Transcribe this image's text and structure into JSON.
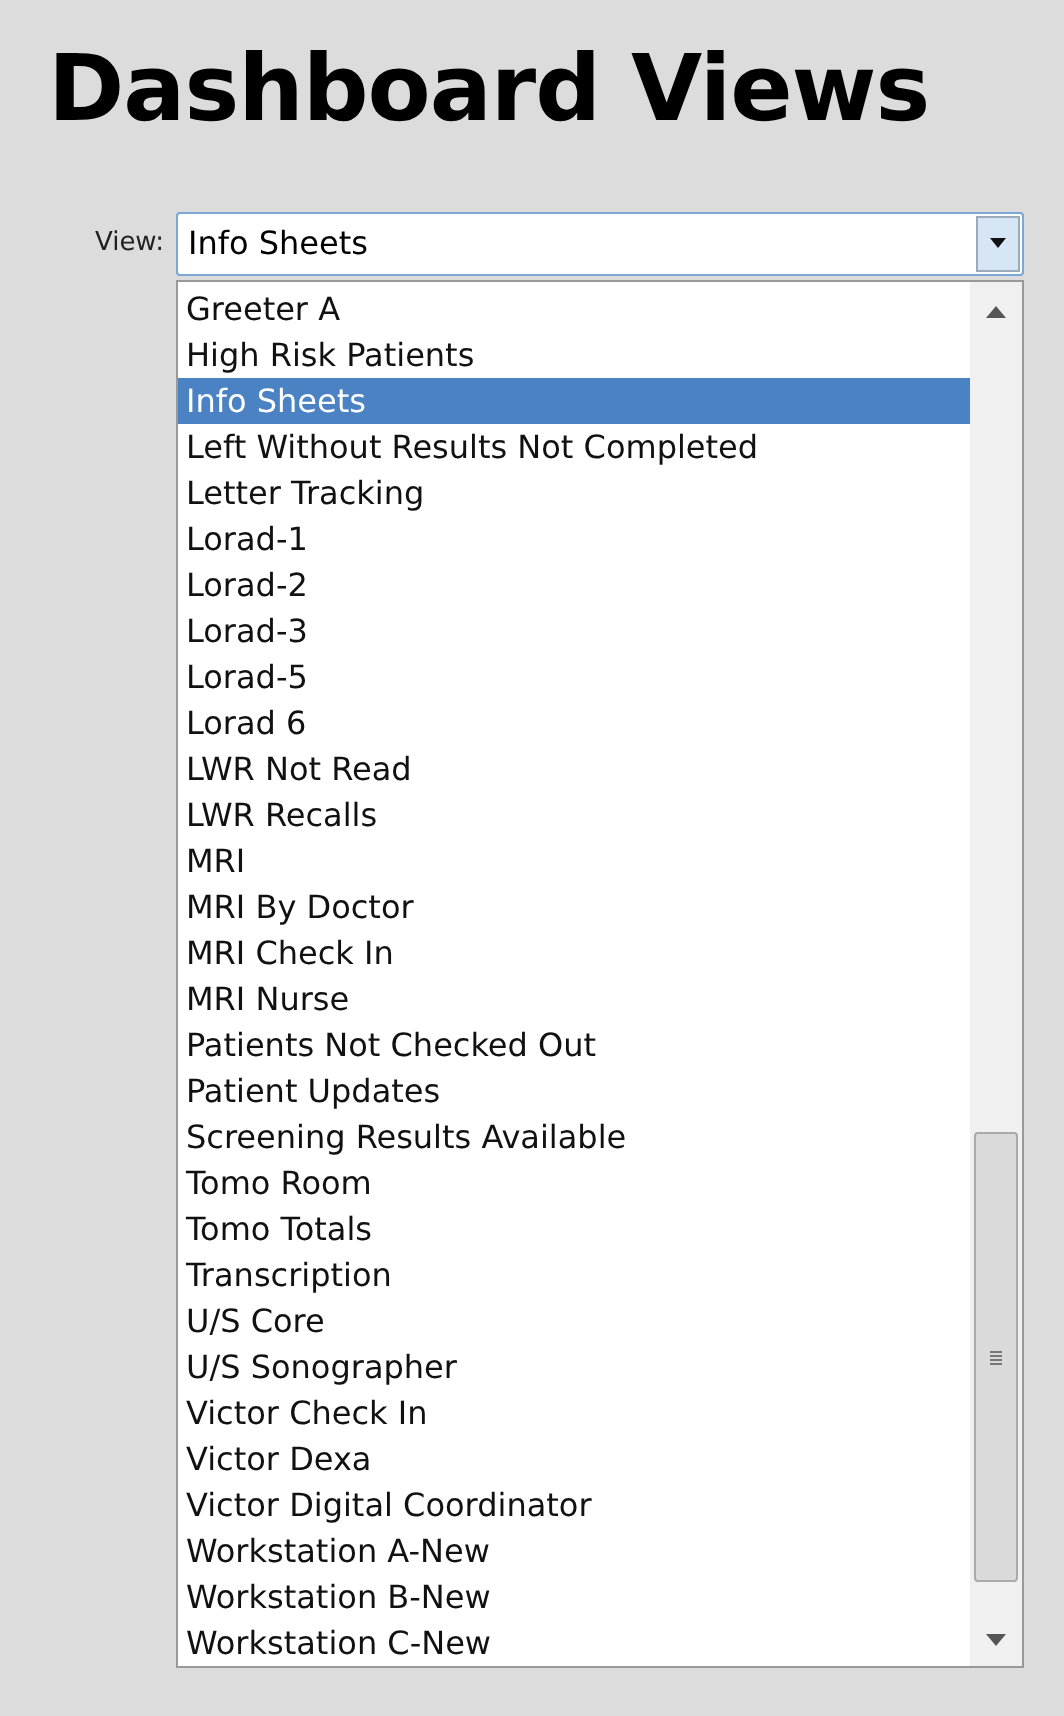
{
  "heading": "Dashboard Views",
  "view_select": {
    "label": "View:",
    "value": "Info Sheets"
  },
  "options": [
    {
      "label": "Greeter A",
      "selected": false
    },
    {
      "label": "High Risk Patients",
      "selected": false
    },
    {
      "label": "Info Sheets",
      "selected": true
    },
    {
      "label": "Left Without Results Not Completed",
      "selected": false
    },
    {
      "label": "Letter Tracking",
      "selected": false
    },
    {
      "label": "Lorad-1",
      "selected": false
    },
    {
      "label": "Lorad-2",
      "selected": false
    },
    {
      "label": "Lorad-3",
      "selected": false
    },
    {
      "label": "Lorad-5",
      "selected": false
    },
    {
      "label": "Lorad 6",
      "selected": false
    },
    {
      "label": "LWR Not Read",
      "selected": false
    },
    {
      "label": "LWR Recalls",
      "selected": false
    },
    {
      "label": "MRI",
      "selected": false
    },
    {
      "label": "MRI By Doctor",
      "selected": false
    },
    {
      "label": "MRI Check In",
      "selected": false
    },
    {
      "label": "MRI Nurse",
      "selected": false
    },
    {
      "label": "Patients Not Checked Out",
      "selected": false
    },
    {
      "label": "Patient Updates",
      "selected": false
    },
    {
      "label": "Screening Results Available",
      "selected": false
    },
    {
      "label": "Tomo Room",
      "selected": false
    },
    {
      "label": "Tomo Totals",
      "selected": false
    },
    {
      "label": "Transcription",
      "selected": false
    },
    {
      "label": "U/S Core",
      "selected": false
    },
    {
      "label": "U/S Sonographer",
      "selected": false
    },
    {
      "label": "Victor Check In",
      "selected": false
    },
    {
      "label": "Victor Dexa",
      "selected": false
    },
    {
      "label": "Victor Digital Coordinator",
      "selected": false
    },
    {
      "label": "Workstation A-New",
      "selected": false
    },
    {
      "label": "Workstation B-New",
      "selected": false
    },
    {
      "label": "Workstation C-New",
      "selected": false
    }
  ]
}
